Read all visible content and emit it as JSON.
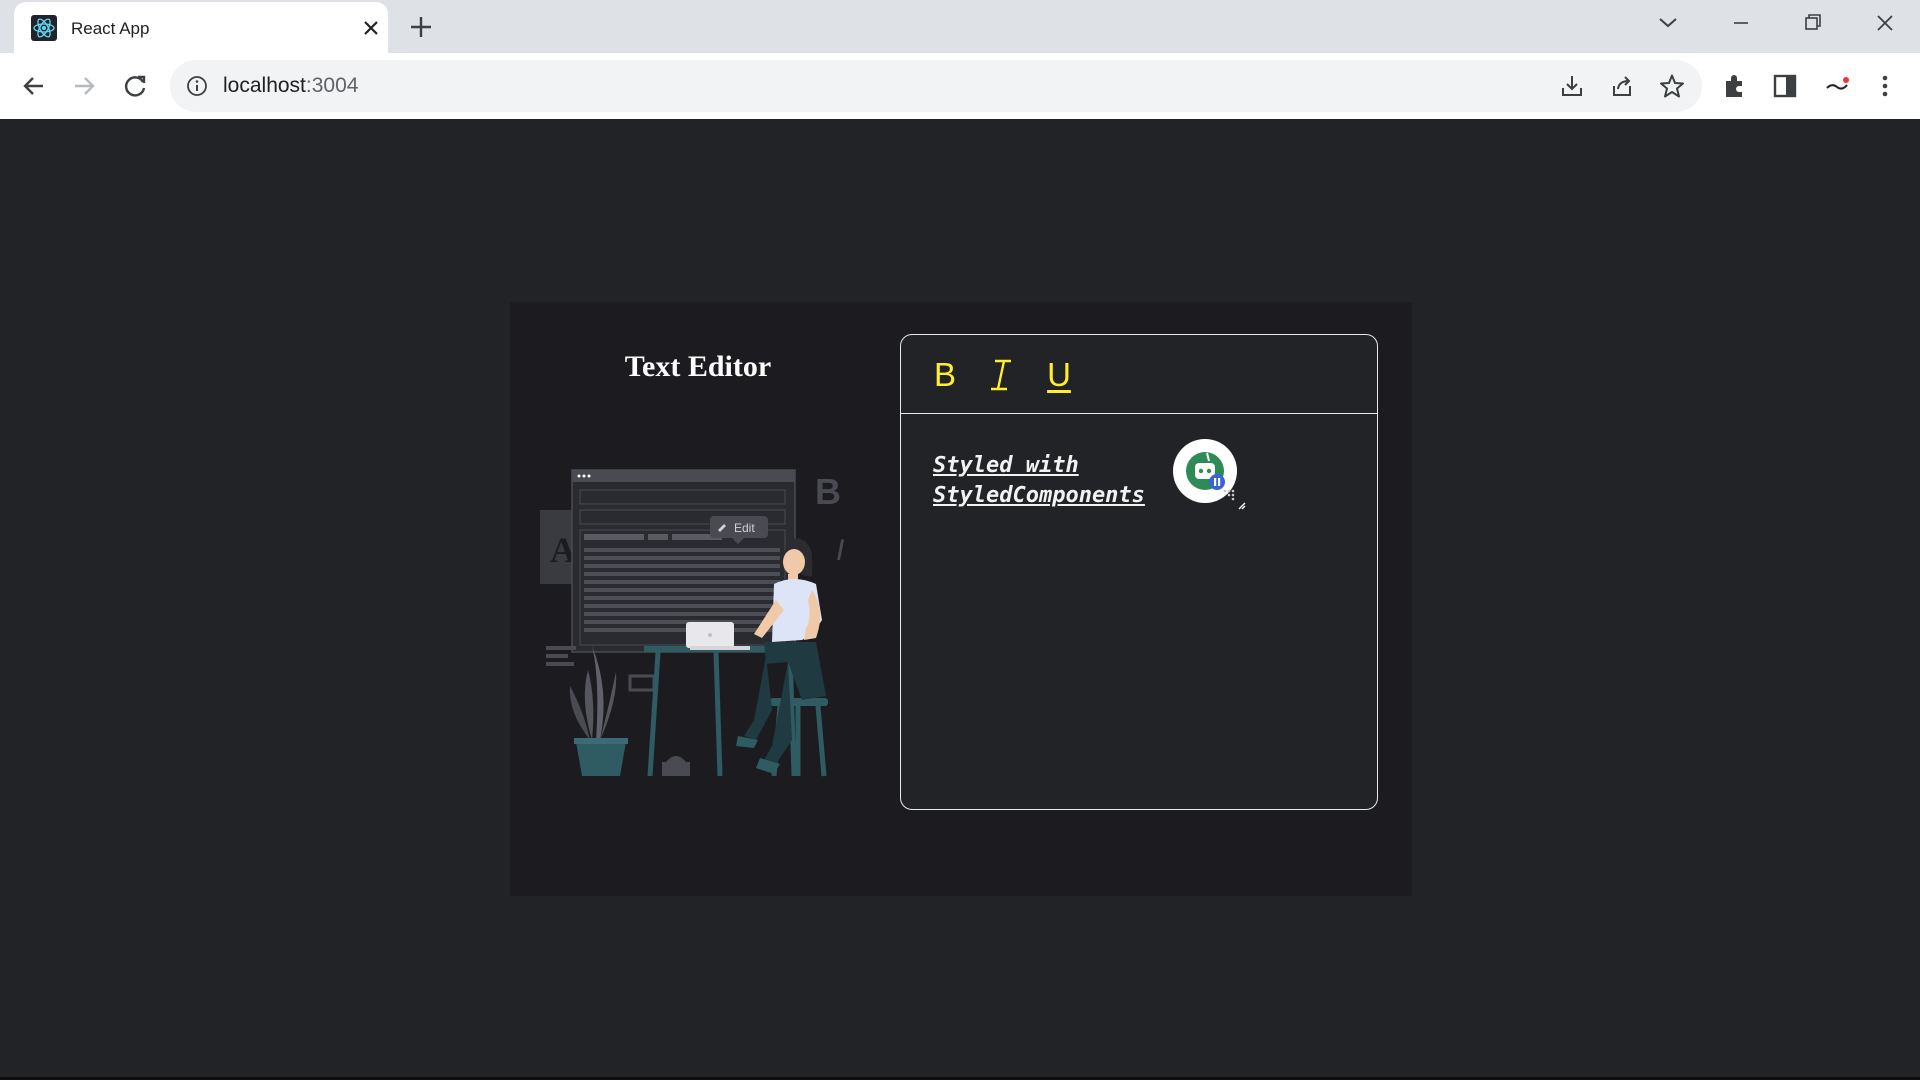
{
  "browser": {
    "tab_title": "React App",
    "url_host": "localhost",
    "url_port": ":3004",
    "favicon": "react-logo-icon"
  },
  "app": {
    "heading": "Text Editor",
    "toolbar": {
      "bold_label": "B",
      "italic_label": "I",
      "underline_label": "U"
    },
    "content_text": "Styled with StyledComponents",
    "illustration": {
      "tooltip_label": "Edit",
      "letters": [
        "A",
        "B",
        "I"
      ]
    }
  },
  "colors": {
    "page_background": "#222327",
    "card_background": "#1c1c20",
    "accent_yellow": "#ffee2e",
    "border": "#e9e9ea"
  }
}
